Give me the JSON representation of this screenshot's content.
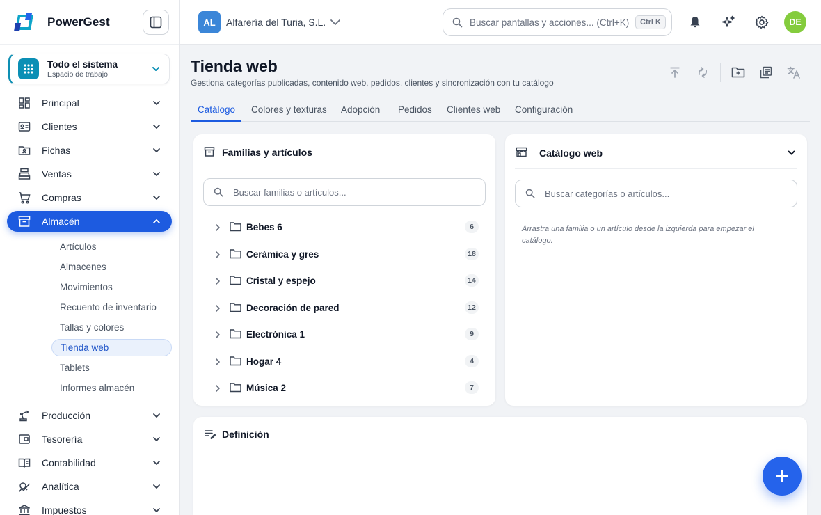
{
  "brand": {
    "name": "PowerGest",
    "logo_icon": "powergest-logo-icon"
  },
  "workspace": {
    "name": "Todo el sistema",
    "subtitle": "Espacio de trabajo"
  },
  "sidebar": {
    "items": [
      {
        "label": "Principal",
        "icon": "dashboard-grid-icon"
      },
      {
        "label": "Clientes",
        "icon": "id-card-icon"
      },
      {
        "label": "Fichas",
        "icon": "folder-person-icon"
      },
      {
        "label": "Ventas",
        "icon": "cash-register-icon"
      },
      {
        "label": "Compras",
        "icon": "cart-icon"
      },
      {
        "label": "Almacén",
        "icon": "archive-box-icon",
        "active": true
      },
      {
        "label": "Producción",
        "icon": "robot-arm-icon"
      },
      {
        "label": "Tesorería",
        "icon": "wallet-icon"
      },
      {
        "label": "Contabilidad",
        "icon": "ledger-book-icon"
      },
      {
        "label": "Analítica",
        "icon": "analytics-icon"
      },
      {
        "label": "Impuestos",
        "icon": "bank-icon"
      }
    ],
    "subitems": [
      "Artículos",
      "Almacenes",
      "Movimientos",
      "Recuento de inventario",
      "Tallas y colores",
      "Tienda web",
      "Tablets",
      "Informes almacén"
    ],
    "active_subitem": "Tienda web"
  },
  "topbar": {
    "company_initials": "AL",
    "company_name": "Alfarería del Turia, S.L.",
    "search_placeholder": "Buscar pantallas y acciones... (Ctrl+K)",
    "search_shortcut": "Ctrl K",
    "user_initials": "DE"
  },
  "page": {
    "title": "Tienda web",
    "subtitle": "Gestiona categorías publicadas, contenido web, pedidos, clientes y sincronización con tu catálogo"
  },
  "tabs": [
    "Catálogo",
    "Colores y texturas",
    "Adopción",
    "Pedidos",
    "Clientes web",
    "Configuración"
  ],
  "active_tab": "Catálogo",
  "families_panel": {
    "title": "Familias y artículos",
    "search_placeholder": "Buscar familias o artículos...",
    "families": [
      {
        "name": "Bebes 6",
        "count": "6"
      },
      {
        "name": "Cerámica y gres",
        "count": "18"
      },
      {
        "name": "Cristal y espejo",
        "count": "14"
      },
      {
        "name": "Decoración de pared",
        "count": "12"
      },
      {
        "name": "Electrónica 1",
        "count": "9"
      },
      {
        "name": "Hogar 4",
        "count": "4"
      },
      {
        "name": "Música 2",
        "count": "7"
      }
    ]
  },
  "web_catalog_panel": {
    "title": "Catálogo web",
    "search_placeholder": "Buscar categorías o artículos...",
    "empty_hint": "Arrastra una familia o un artículo desde la izquierda para empezar el catálogo."
  },
  "definition_panel": {
    "title": "Definición"
  },
  "colors": {
    "accent": "#1d5be0",
    "workspace": "#0b8fb5",
    "avatar": "#84cc3d",
    "company": "#3b86d8",
    "fab": "#2563eb"
  }
}
